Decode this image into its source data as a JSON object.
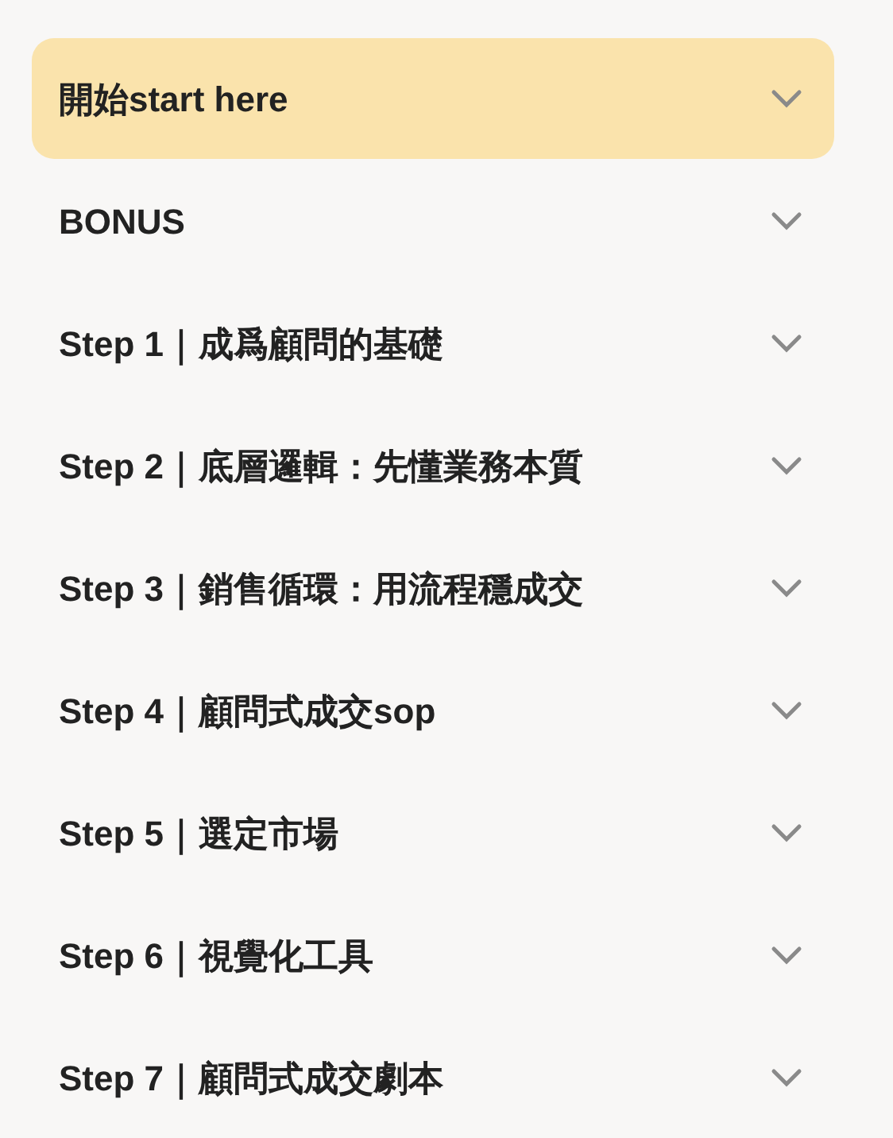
{
  "menu": [
    {
      "label": "開始start here",
      "selected": true
    },
    {
      "label": "BONUS",
      "selected": false
    },
    {
      "label": "Step 1｜成爲顧問的基礎",
      "selected": false
    },
    {
      "label": "Step 2｜底層邏輯：先懂業務本質",
      "selected": false
    },
    {
      "label": "Step 3｜銷售循環：用流程穩成交",
      "selected": false
    },
    {
      "label": "Step 4｜顧問式成交sop",
      "selected": false
    },
    {
      "label": "Step 5｜選定市場",
      "selected": false
    },
    {
      "label": "Step 6｜視覺化工具",
      "selected": false
    },
    {
      "label": "Step 7｜顧問式成交劇本",
      "selected": false
    }
  ]
}
